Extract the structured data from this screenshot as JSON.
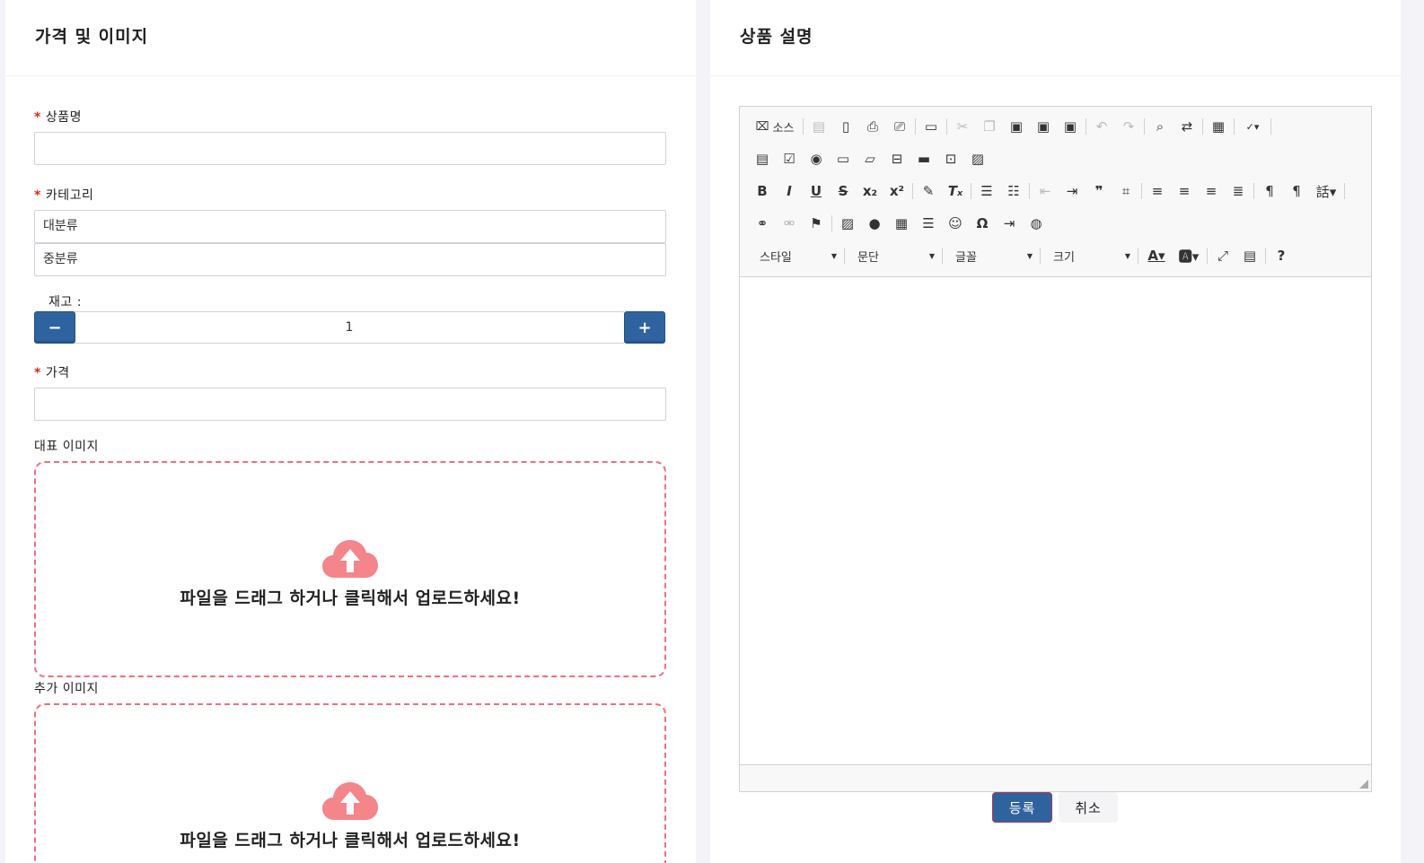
{
  "left_panel": {
    "title": "가격 및 이미지",
    "product_name": {
      "label": "상품명",
      "value": ""
    },
    "category": {
      "label": "카테고리",
      "major": "대분류",
      "minor": "중분류"
    },
    "stock": {
      "label": "재고 :",
      "value": "1",
      "minus": "−",
      "plus": "+"
    },
    "price": {
      "label": "가격",
      "value": ""
    },
    "main_image": {
      "label": "대표 이미지",
      "prompt": "파일을 드래그 하거나 클릭해서 업로드하세요!"
    },
    "extra_image": {
      "label": "추가 이미지",
      "prompt": "파일을 드래그 하거나 클릭해서 업로드하세요!"
    }
  },
  "right_panel": {
    "title": "상품 설명",
    "toolbar": {
      "source_label": "소스",
      "style_label": "스타일",
      "paragraph_label": "문단",
      "font_label": "글꼴",
      "size_label": "크기",
      "help": "?"
    },
    "submit_label": "등록",
    "cancel_label": "취소"
  },
  "colors": {
    "accent": "#2f63a0",
    "dropzone_border": "#ef7077",
    "required": "#e0261c"
  }
}
